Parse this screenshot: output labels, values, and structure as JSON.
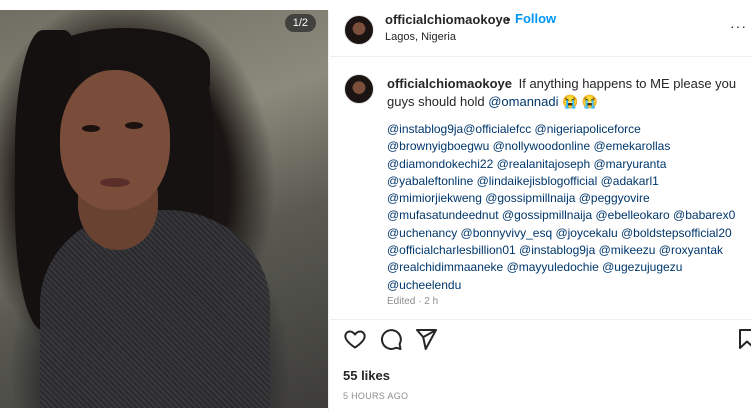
{
  "post": {
    "image_counter": "1/2",
    "header": {
      "username": "officialchiomaokoye",
      "separator": "•",
      "follow_label": "Follow",
      "location": "Lagos, Nigeria"
    },
    "caption": {
      "username": "officialchiomaokoye",
      "text": "If anything happens to ME please you guys should hold",
      "mention": "@omannadi",
      "emoji": "😭 😭",
      "tag_lines": [
        "@instablog9ja@officialefcc @nigeriapoliceforce",
        "@brownyigboegwu @nollywoodonline @emekarollas",
        "@diamondokechi22 @realanitajoseph @maryuranta",
        "@yabaleftonline @lindaikejisblogofficial @adakarl1",
        "@mimiorjiekweng @gossipmillnaija @peggyovire",
        "@mufasatundeednut @gossipmillnaija @ebelleokaro @babarex0",
        "@uchenancy @bonnyvivy_esq @joycekalu @boldstepsofficial20",
        "@officialcharlesbillion01 @instablog9ja @mikeezu @roxyantak",
        "@realchidimmaaneke @mayyuledochie @ugezujugezu",
        "@ucheelendu"
      ],
      "edited": "Edited · 2 h"
    },
    "likes": "55 likes",
    "time": "5 HOURS AGO",
    "icons": [
      "heart-icon",
      "comment-icon",
      "share-icon",
      "bookmark-icon",
      "more-options-icon"
    ]
  }
}
